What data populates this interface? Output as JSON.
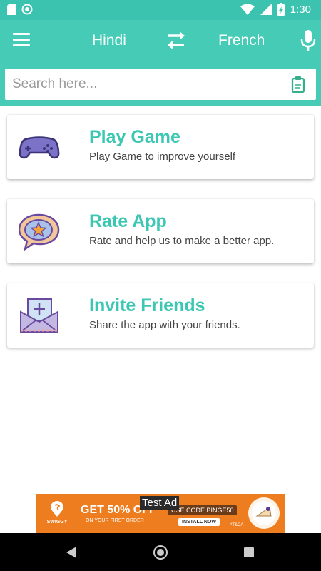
{
  "status_bar": {
    "time": "1:30"
  },
  "toolbar": {
    "source_language": "Hindi",
    "target_language": "French"
  },
  "search": {
    "placeholder": "Search here..."
  },
  "cards": [
    {
      "title": "Play Game",
      "subtitle": "Play Game to improve yourself",
      "icon": "gamepad-icon"
    },
    {
      "title": "Rate App",
      "subtitle": "Rate and help us to make a better app.",
      "icon": "star-bubble-icon"
    },
    {
      "title": "Invite Friends",
      "subtitle": "Share the app with your friends.",
      "icon": "envelope-invite-icon"
    }
  ],
  "ad": {
    "tag": "Test Ad",
    "brand": "SWIGGY",
    "headline": "GET 50% OFF",
    "subline": "ON YOUR FIRST ORDER",
    "code": "USE CODE BINGE50",
    "install": "INSTALL NOW",
    "tc": "*T&CA"
  },
  "colors": {
    "primary": "#45cbb6",
    "status_bar": "#3cc3b0",
    "card_title": "#3cc7b3",
    "ad_background": "#ee7d1f"
  }
}
